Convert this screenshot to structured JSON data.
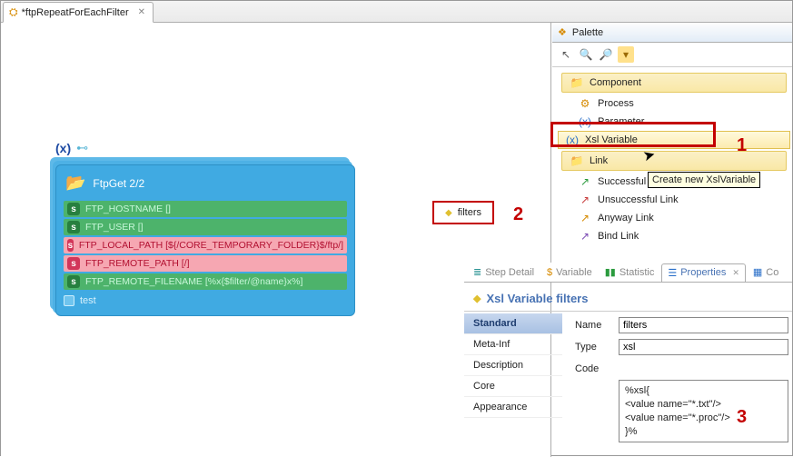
{
  "editor": {
    "tab_label": "*ftpRepeatForEachFilter",
    "close_glyph": "✕"
  },
  "canvas": {
    "var_glyph": "(x)",
    "link_glyph": "⊷",
    "card": {
      "title": "FtpGet 2/2",
      "rows": [
        {
          "kind": "green",
          "label": "FTP_HOSTNAME []"
        },
        {
          "kind": "green",
          "label": "FTP_USER []"
        },
        {
          "kind": "pink",
          "label": "FTP_LOCAL_PATH [${/CORE_TEMPORARY_FOLDER}$/ftp/]"
        },
        {
          "kind": "pink",
          "label": "FTP_REMOTE_PATH [/]"
        },
        {
          "kind": "green",
          "label": "FTP_REMOTE_FILENAME [%x{$filter/@name}x%]"
        }
      ],
      "footer": "test"
    },
    "filters_node_label": "filters"
  },
  "palette": {
    "title": "Palette",
    "drawers": {
      "component": "Component",
      "link": "Link"
    },
    "component_items": [
      {
        "icon": "⚙",
        "cls": "c-orange",
        "label": "Process"
      },
      {
        "icon": "(x)",
        "cls": "c-blue",
        "label": "Parameter"
      },
      {
        "icon": "(x)",
        "cls": "c-blue",
        "label": "Xsl Variable",
        "hover": true
      }
    ],
    "link_items": [
      {
        "icon": "↗",
        "cls": "c-green",
        "label": "Successful Link"
      },
      {
        "icon": "↗",
        "cls": "c-red",
        "label": "Unsuccessful Link"
      },
      {
        "icon": "↗",
        "cls": "c-orange",
        "label": "Anyway Link"
      },
      {
        "icon": "↗",
        "cls": "c-purple",
        "label": "Bind Link"
      }
    ],
    "tooltip": "Create new XslVariable"
  },
  "props": {
    "tabs": [
      {
        "icon": "≣",
        "cls": "c-teal",
        "label": "Step Detail"
      },
      {
        "icon": "$",
        "cls": "c-orange",
        "label": "Variable"
      },
      {
        "icon": "▮▮",
        "cls": "c-green",
        "label": "Statistic"
      },
      {
        "icon": "☰",
        "cls": "c-blue",
        "label": "Properties",
        "active": true,
        "closeable": true
      },
      {
        "icon": "▦",
        "cls": "c-blue",
        "label": "Co"
      }
    ],
    "header": "Xsl Variable filters",
    "categories": [
      {
        "label": "Standard",
        "active": true
      },
      {
        "label": "Meta-Inf"
      },
      {
        "label": "Description"
      },
      {
        "label": "Core"
      },
      {
        "label": "Appearance"
      }
    ],
    "fields": {
      "name_label": "Name",
      "name_value": "filters",
      "type_label": "Type",
      "type_value": "xsl",
      "code_label": "Code",
      "code_value": "%xsl{\n<value name=\"*.txt\"/>\n<value name=\"*.proc\"/>\n}%"
    }
  },
  "annotations": {
    "a1": "1",
    "a2": "2",
    "a3": "3"
  }
}
